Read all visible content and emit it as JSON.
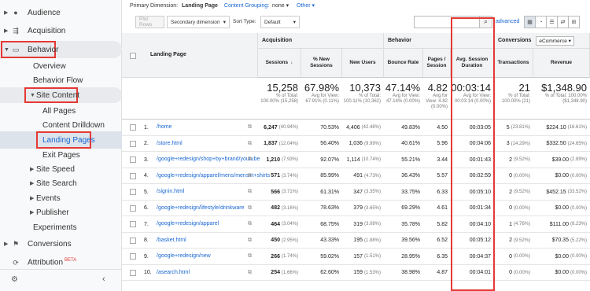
{
  "sidebar": {
    "items": [
      {
        "label": "Audience",
        "icon": "person-icon"
      },
      {
        "label": "Acquisition",
        "icon": "acquisition-icon"
      },
      {
        "label": "Behavior",
        "icon": "behavior-icon"
      },
      {
        "label": "Overview"
      },
      {
        "label": "Behavior Flow"
      },
      {
        "label": "Site Content"
      },
      {
        "label": "All Pages"
      },
      {
        "label": "Content Drilldown"
      },
      {
        "label": "Landing Pages"
      },
      {
        "label": "Exit Pages"
      },
      {
        "label": "Site Speed"
      },
      {
        "label": "Site Search"
      },
      {
        "label": "Events"
      },
      {
        "label": "Publisher"
      },
      {
        "label": "Experiments"
      },
      {
        "label": "Conversions",
        "icon": "flag-icon"
      },
      {
        "label": "Attribution",
        "icon": "attribution-icon",
        "badge": "BETA"
      }
    ]
  },
  "topbar": {
    "primary_dimension_label": "Primary Dimension:",
    "primary_dimension_value": "Landing Page",
    "content_grouping": "Content Grouping:",
    "content_grouping_value": "none",
    "other": "Other"
  },
  "toolbar": {
    "plot_rows": "Plot Rows",
    "secondary_dimension": "Secondary dimension",
    "sort_type_label": "Sort Type:",
    "sort_type_value": "Default",
    "advanced": "advanced",
    "ecommerce": "eCommerce"
  },
  "table": {
    "groups": {
      "acquisition": "Acquisition",
      "behavior": "Behavior",
      "conversions": "Conversions"
    },
    "headers": {
      "landing_page": "Landing Page",
      "sessions": "Sessions",
      "new_sessions": "% New Sessions",
      "new_users": "New Users",
      "bounce_rate": "Bounce Rate",
      "pages_session": "Pages / Session",
      "avg_duration": "Avg. Session Duration",
      "transactions": "Transactions",
      "revenue": "Revenue"
    },
    "totals": {
      "sessions": "15,258",
      "sessions_sub": "% of Total: 100.00% (15,258)",
      "new_sessions": "67.98%",
      "new_sessions_sub": "Avg for View: 67.91% (0.11%)",
      "new_users": "10,373",
      "new_users_sub": "% of Total: 100.11% (10,362)",
      "bounce_rate": "47.14%",
      "bounce_rate_sub": "Avg for View: 47.14% (0.00%)",
      "pages": "4.82",
      "pages_sub": "Avg for View: 4.82 (0.00%)",
      "duration": "00:03:14",
      "duration_sub": "Avg for View: 00:03:14 (0.00%)",
      "transactions": "21",
      "transactions_sub": "% of Total: 100.00% (21)",
      "revenue": "$1,348.90",
      "revenue_sub": "% of Total: 100.00% ($1,348.90)"
    },
    "rows": [
      {
        "n": "1.",
        "page": "/home",
        "sessions": "6,247",
        "sp": "(40.94%)",
        "ns": "70.53%",
        "nu": "4,406",
        "nup": "(42.48%)",
        "br": "49.83%",
        "ps": "4.50",
        "dur": "00:03:05",
        "tx": "5",
        "txp": "(23.81%)",
        "rev": "$224.10",
        "revp": "(16.61%)"
      },
      {
        "n": "2.",
        "page": "/store.html",
        "sessions": "1,837",
        "sp": "(12.04%)",
        "ns": "56.40%",
        "nu": "1,036",
        "nup": "(9.99%)",
        "br": "40.61%",
        "ps": "5.96",
        "dur": "00:04:06",
        "tx": "3",
        "txp": "(14.29%)",
        "rev": "$332.50",
        "revp": "(24.65%)"
      },
      {
        "n": "3.",
        "page": "/google+redesign/shop+by+brand/youtube",
        "sessions": "1,210",
        "sp": "(7.93%)",
        "ns": "92.07%",
        "nu": "1,114",
        "nup": "(10.74%)",
        "br": "55.21%",
        "ps": "3.44",
        "dur": "00:01:43",
        "tx": "2",
        "txp": "(9.52%)",
        "rev": "$39.00",
        "revp": "(2.89%)"
      },
      {
        "n": "4.",
        "page": "/google+redesign/apparel/mens/mens+t+shirts",
        "sessions": "571",
        "sp": "(3.74%)",
        "ns": "85.99%",
        "nu": "491",
        "nup": "(4.73%)",
        "br": "36.43%",
        "ps": "5.57",
        "dur": "00:02:59",
        "tx": "0",
        "txp": "(0.00%)",
        "rev": "$0.00",
        "revp": "(0.00%)"
      },
      {
        "n": "5.",
        "page": "/signin.html",
        "sessions": "566",
        "sp": "(3.71%)",
        "ns": "61.31%",
        "nu": "347",
        "nup": "(3.35%)",
        "br": "33.75%",
        "ps": "6.33",
        "dur": "00:05:10",
        "tx": "2",
        "txp": "(9.52%)",
        "rev": "$452.15",
        "revp": "(33.52%)"
      },
      {
        "n": "6.",
        "page": "/google+redesign/lifestyle/drinkware",
        "sessions": "482",
        "sp": "(3.16%)",
        "ns": "78.63%",
        "nu": "379",
        "nup": "(3.65%)",
        "br": "69.29%",
        "ps": "4.61",
        "dur": "00:01:34",
        "tx": "0",
        "txp": "(0.00%)",
        "rev": "$0.00",
        "revp": "(0.00%)"
      },
      {
        "n": "7.",
        "page": "/google+redesign/apparel",
        "sessions": "464",
        "sp": "(3.04%)",
        "ns": "68.75%",
        "nu": "319",
        "nup": "(3.08%)",
        "br": "35.78%",
        "ps": "5.82",
        "dur": "00:04:10",
        "tx": "1",
        "txp": "(4.76%)",
        "rev": "$111.00",
        "revp": "(8.23%)"
      },
      {
        "n": "8.",
        "page": "/basket.html",
        "sessions": "450",
        "sp": "(2.95%)",
        "ns": "43.33%",
        "nu": "195",
        "nup": "(1.88%)",
        "br": "39.56%",
        "ps": "6.52",
        "dur": "00:05:12",
        "tx": "2",
        "txp": "(9.52%)",
        "rev": "$70.35",
        "revp": "(5.22%)"
      },
      {
        "n": "9.",
        "page": "/google+redesign/new",
        "sessions": "266",
        "sp": "(1.74%)",
        "ns": "59.02%",
        "nu": "157",
        "nup": "(1.51%)",
        "br": "28.95%",
        "ps": "6.35",
        "dur": "00:04:37",
        "tx": "0",
        "txp": "(0.00%)",
        "rev": "$0.00",
        "revp": "(0.00%)"
      },
      {
        "n": "10.",
        "page": "/asearch.html",
        "sessions": "254",
        "sp": "(1.66%)",
        "ns": "62.60%",
        "nu": "159",
        "nup": "(1.53%)",
        "br": "38.98%",
        "ps": "4.87",
        "dur": "00:04:01",
        "tx": "0",
        "txp": "(0.00%)",
        "rev": "$0.00",
        "revp": "(0.00%)"
      }
    ]
  },
  "colors": {
    "accent": "#1967d2",
    "highlight": "#e53935"
  }
}
